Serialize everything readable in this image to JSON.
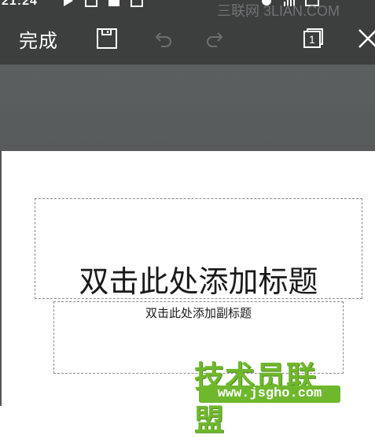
{
  "status_bar": {
    "time": "21:24",
    "icons": [
      "play-icon",
      "image-icon",
      "notification-icon",
      "notification-icon",
      "alarm-icon",
      "signal-icon",
      "battery-icon"
    ]
  },
  "toolbar": {
    "done_label": "完成",
    "save_icon": "save-icon",
    "undo_icon": "undo-icon",
    "redo_icon": "redo-icon",
    "pages_icon": "page-count-icon",
    "page_count": "1",
    "close_icon": "close-icon"
  },
  "watermarks": {
    "top": "三联网 3LIAN.COM",
    "logo_text": "技术员联盟",
    "logo_url": "www.jsgho.com"
  },
  "slide": {
    "title_placeholder": "双击此处添加标题",
    "subtitle_placeholder": "双击此处添加副标题"
  },
  "colors": {
    "toolbar_bg": "#3d3f3f",
    "band_bg": "#5b5f5f",
    "watermark_green": "#6fb82d"
  }
}
